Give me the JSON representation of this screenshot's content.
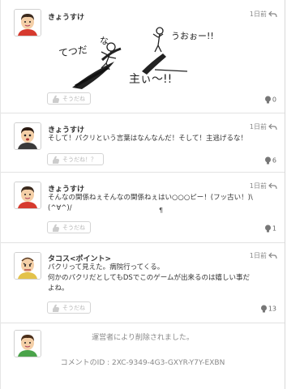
{
  "posts": [
    {
      "author": "きょうすけ",
      "time": "1日前",
      "yeah_label": "そうだね",
      "count": "0",
      "drawing_texts": [
        "てつだ",
        "な",
        "うおぉー!!",
        "主ぃ〜!!"
      ]
    },
    {
      "author": "きょうすけ",
      "time": "1日前",
      "text": "そして！パクリという言葉はなんなんだ！そして！主逃げるな！",
      "yeah_label": "そうだね！？",
      "count": "6"
    },
    {
      "author": "きょうすけ",
      "time": "1日前",
      "text_line1": "そんなの関係ねぇそんなの関係ねぇはい○○○ピー！(フッ古い！)\\",
      "text_line2": "(^∀^)/",
      "pilcrow": "¶",
      "yeah_label": "そうだね",
      "count": "1"
    },
    {
      "author": "タコス<ポイント>",
      "time": "1日前",
      "text_line1": "パクリって見えた。病院行ってくる。",
      "text_line2": "何かのパクリだとしてもDSでこのゲームが出来るのは嬉しい事だ",
      "text_line3": "よね。",
      "yeah_label": "そうだね",
      "count": "13"
    },
    {
      "deleted_message": "運営者により削除されました。",
      "comment_id": "コメントのID : 2XC-9349-4G3-GXYR-Y7Y-EXBN"
    }
  ],
  "colors": {
    "accent": "#7ec8e3",
    "text": "#333333",
    "muted": "#888888"
  },
  "icons": {
    "reply": "reply-arrow-icon",
    "yeah": "yeah-hand-icon",
    "count": "empathy-bulb-icon"
  }
}
